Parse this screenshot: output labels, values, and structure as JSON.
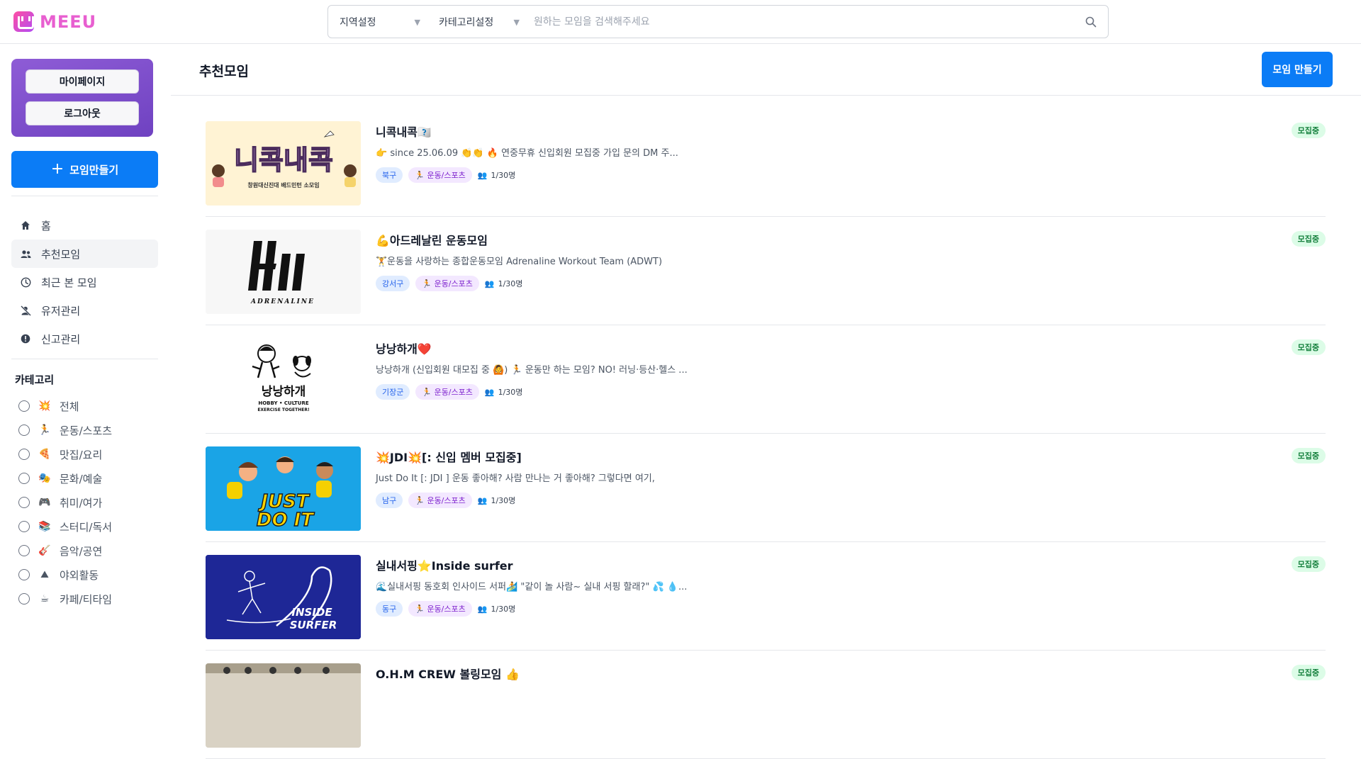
{
  "brand": {
    "name": "MEEU"
  },
  "search": {
    "region_label": "지역설정",
    "category_label": "카테고리설정",
    "placeholder": "원하는 모임을 검색해주세요"
  },
  "sidebar": {
    "mypage_label": "마이페이지",
    "logout_label": "로그아웃",
    "create_label": "모임만들기",
    "nav": [
      {
        "label": "홈",
        "icon": "home-icon"
      },
      {
        "label": "추천모임",
        "icon": "group-icon",
        "active": true
      },
      {
        "label": "최근 본 모임",
        "icon": "clock-icon"
      },
      {
        "label": "유저관리",
        "icon": "user-off-icon"
      },
      {
        "label": "신고관리",
        "icon": "alert-icon"
      }
    ],
    "category_title": "카테고리",
    "categories": [
      {
        "emoji": "💥",
        "label": "전체"
      },
      {
        "emoji": "🏃",
        "label": "운동/스포츠"
      },
      {
        "emoji": "🍕",
        "label": "맛집/요리"
      },
      {
        "emoji": "🎭",
        "label": "문화/예술"
      },
      {
        "emoji": "🎮",
        "label": "취미/여가"
      },
      {
        "emoji": "📚",
        "label": "스터디/독서"
      },
      {
        "emoji": "🎸",
        "label": "음악/공연"
      },
      {
        "emoji": "⛰",
        "label": "야외활동"
      },
      {
        "emoji": "☕",
        "label": "카페/티타임"
      }
    ]
  },
  "main": {
    "title": "추천모임",
    "make_label": "모임 만들기",
    "meetings": [
      {
        "title": "니콕내콕🇽🇽",
        "desc": "👉 since 25.06.09 👏👏 🔥 연중무휴 신입회원 모집중 가입 문의 DM 주...",
        "region": "북구",
        "category": "🏃 운동/스포츠",
        "count": "1/30명",
        "status": "모집중",
        "thumb_text": "니콕내콕",
        "thumb_sub": "창원대신진대 배드민턴 소모임"
      },
      {
        "title": "💪아드레날린 운동모임",
        "desc": "🏋운동을 사랑하는 종합운동모임 Adrenaline Workout Team (ADWT)",
        "region": "강서구",
        "category": "🏃 운동/스포츠",
        "count": "1/30명",
        "status": "모집중",
        "thumb_text": "ADRENALINE"
      },
      {
        "title": "낭낭하개❤️",
        "desc": "낭낭하개 (신입회원 대모집 중 🙆) 🏃 운동만 하는 모임? NO! 러닝·등산·헬스 ...",
        "region": "기장군",
        "category": "🏃 운동/스포츠",
        "count": "1/30명",
        "status": "모집중",
        "thumb_text": "낭낭하개",
        "thumb_sub": "HOBBY • CULTURE",
        "thumb_sub2": "EXERCISE TOGETHER!"
      },
      {
        "title": "💥JDI💥[: 신입 멤버 모집중]",
        "desc": "Just Do It [: JDI ] 운동 좋아해? 사람 만나는 거 좋아해? 그렇다면 여기,",
        "region": "남구",
        "category": "🏃 운동/스포츠",
        "count": "1/30명",
        "status": "모집중",
        "thumb_text": "JUST",
        "thumb_text2": "DO IT"
      },
      {
        "title": "실내서핑⭐Inside surfer",
        "desc": "🌊실내서핑 동호회 인사이드 서퍼🏄 \"같이 놀 사람~ 실내 서핑 할래?\" 💦 💧...",
        "region": "동구",
        "category": "🏃 운동/스포츠",
        "count": "1/30명",
        "status": "모집중",
        "thumb_text": "INSIDE",
        "thumb_text2": "SURFER"
      },
      {
        "title": "O.H.M CREW 볼링모임 👍",
        "desc": "",
        "region": "",
        "category": "",
        "count": "",
        "status": "모집중"
      }
    ]
  },
  "colors": {
    "accent": "#0b7cf6",
    "brand": "#e85fd0",
    "card_purple": "#7a4ccc"
  }
}
